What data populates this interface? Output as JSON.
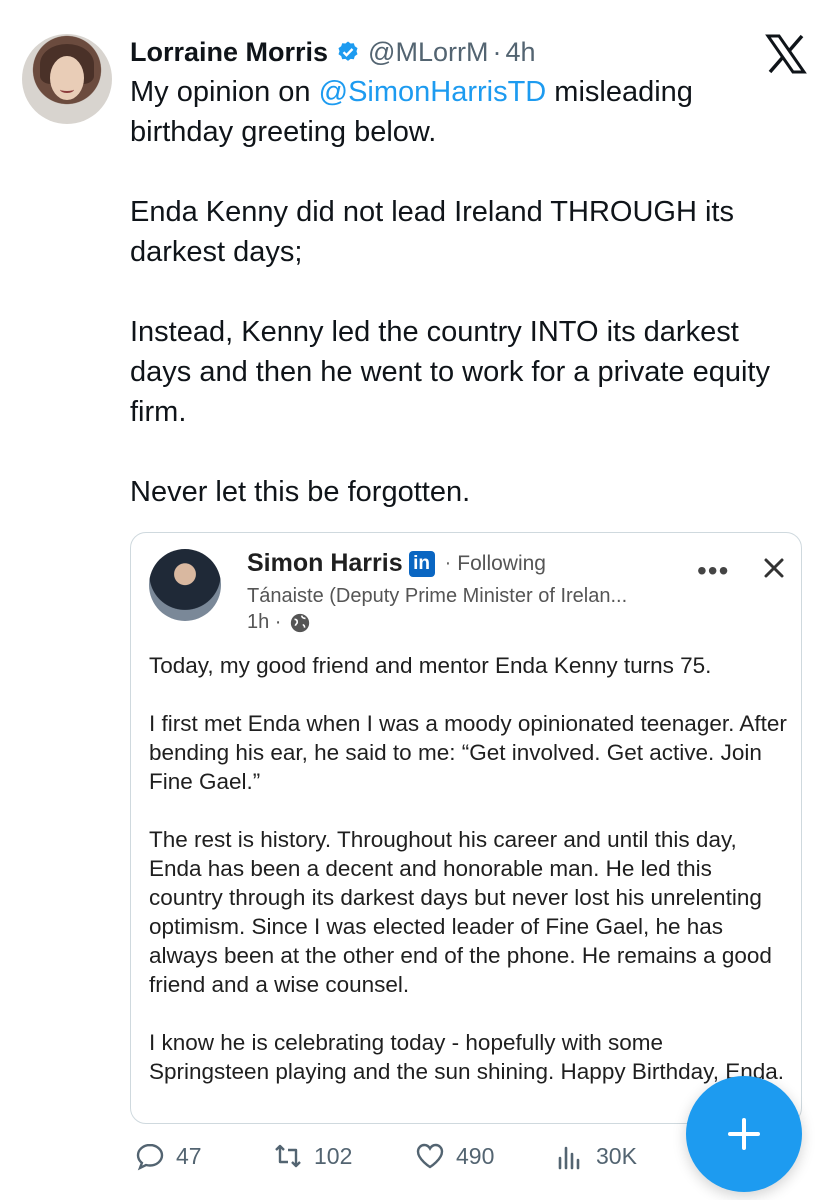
{
  "tweet": {
    "author_name": "Lorraine Morris",
    "handle": "@MLorrM",
    "separator": "·",
    "time": "4h",
    "text_intro": "My opinion on ",
    "mention": "@SimonHarrisTD",
    "text_rest": " misleading birthday greeting below.\n\nEnda Kenny did not lead Ireland THROUGH its darkest days;\n\nInstead, Kenny led the country INTO its darkest days and then he went to work for a private equity firm.\n\nNever let this be forgotten.",
    "icons": {
      "verified": "verified-badge-icon",
      "platform": "x-logo-icon"
    },
    "colors": {
      "accent": "#1d9bf0",
      "muted": "#536471"
    }
  },
  "embedded_post": {
    "name": "Simon Harris",
    "platform_badge": "in",
    "separator": "·",
    "following_label": "Following",
    "title": "Tánaiste (Deputy Prime Minister of Irelan...",
    "time": "1h ·",
    "body": "Today, my good friend and mentor Enda Kenny turns 75.\n\nI first met Enda when I was a moody opinionated teenager. After bending his ear, he said to me: “Get involved. Get active. Join Fine Gael.”\n\nThe rest is history. Throughout his career and until this day, Enda has been a decent and honorable man. He led this country through its darkest days but never lost his unrelenting optimism. Since I was elected leader of Fine Gael, he has always been at the other end of the phone. He remains a good friend and a wise counsel.\n\nI know he is celebrating today - hopefully with some Springsteen playing and the sun shining. Happy Birthday, Enda.",
    "icons": {
      "more": "more-options-icon",
      "close": "close-icon",
      "audience": "globe-icon"
    },
    "colors": {
      "linkedin": "#0a66c2"
    }
  },
  "actions": {
    "replies": "47",
    "reposts": "102",
    "likes": "490",
    "views": "30K"
  },
  "compose_button": {
    "icon": "plus-icon",
    "color": "#1d9bf0"
  }
}
